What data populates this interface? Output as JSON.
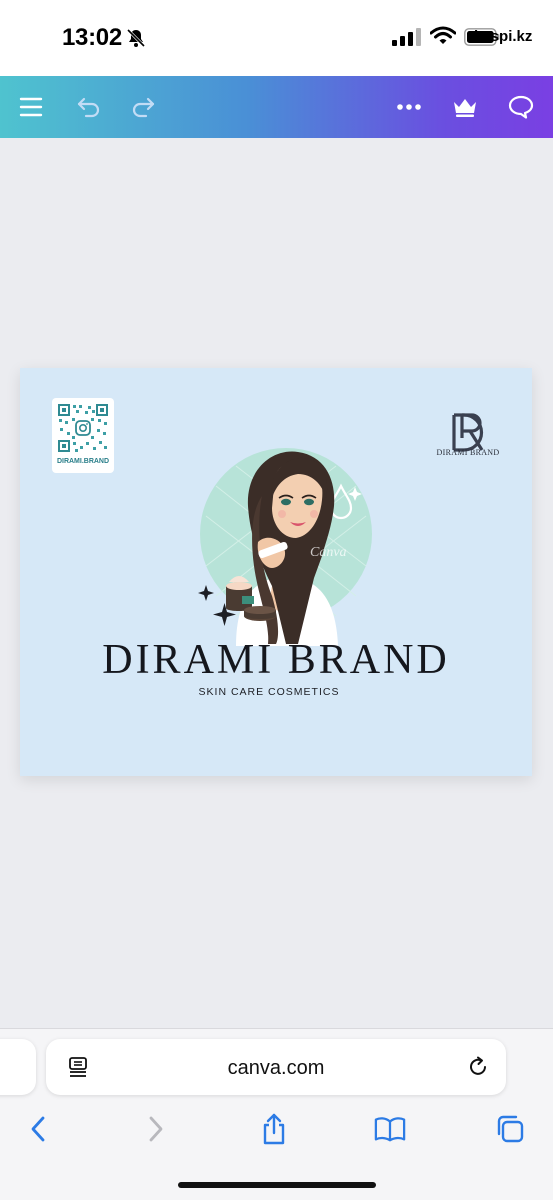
{
  "status_bar": {
    "time": "13:02",
    "carrier": "kaspi.kz",
    "icons": [
      "bell-slash-icon",
      "cellular-signal-icon",
      "wifi-icon",
      "battery-icon"
    ]
  },
  "toolbar": {
    "icons": [
      "menu-icon",
      "undo-icon",
      "redo-icon",
      "more-icon",
      "crown-icon",
      "comment-icon"
    ],
    "gradient": [
      "#4fc3cf",
      "#4a8fd6",
      "#7a3fe3"
    ]
  },
  "design": {
    "background": "#d6e8f7",
    "qr_caption": "DIRAMI.BRAND",
    "logo_caption": "DIRAMI BRAND",
    "title": "DIRAMI BRAND",
    "subtitle": "SKIN CARE COSMETICS",
    "watermark": "Canva"
  },
  "browser": {
    "url": "canva.com",
    "icons": [
      "tab-overview-icon",
      "reload-icon"
    ]
  },
  "bottom_nav": {
    "icons": [
      "back-icon",
      "forward-icon",
      "share-icon",
      "bookmarks-icon",
      "tabs-icon"
    ]
  }
}
